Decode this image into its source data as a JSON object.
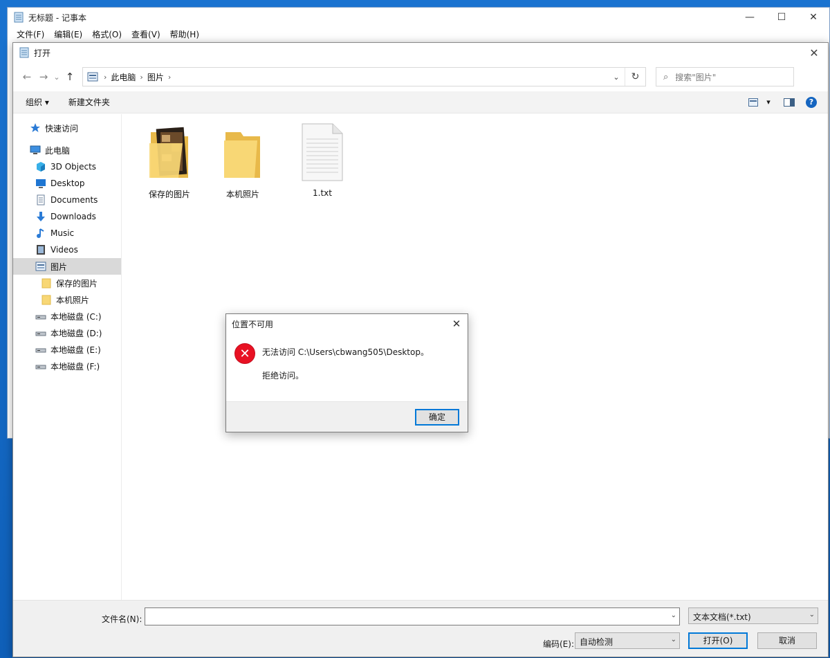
{
  "notepad": {
    "title": "无标题 - 记事本",
    "menu": [
      "文件(F)",
      "编辑(E)",
      "格式(O)",
      "查看(V)",
      "帮助(H)"
    ],
    "minimize": "—",
    "maximize": "☐",
    "close": "✕"
  },
  "open_dialog": {
    "title": "打开",
    "close": "✕",
    "nav": {
      "back": "←",
      "forward": "→",
      "recent": "⌄",
      "up": "↑"
    },
    "address": {
      "crumbs": [
        "此电脑",
        "图片"
      ],
      "separator": "›",
      "dropdown": "⌄",
      "refresh": "↻"
    },
    "search": {
      "placeholder": "搜索\"图片\"",
      "icon": "⌕"
    },
    "commands": {
      "organize": "组织 ▾",
      "new_folder": "新建文件夹"
    },
    "view": {
      "view_arrow": "▾",
      "help": "?"
    },
    "sidebar": [
      {
        "label": "快速访问",
        "icon": "star-icon",
        "indent": 0
      },
      {
        "label": "此电脑",
        "icon": "computer-icon",
        "indent": 0
      },
      {
        "label": "3D Objects",
        "icon": "3d-objects-icon",
        "indent": 1
      },
      {
        "label": "Desktop",
        "icon": "desktop-icon",
        "indent": 1
      },
      {
        "label": "Documents",
        "icon": "document-icon",
        "indent": 1
      },
      {
        "label": "Downloads",
        "icon": "download-icon",
        "indent": 1
      },
      {
        "label": "Music",
        "icon": "music-icon",
        "indent": 1
      },
      {
        "label": "Videos",
        "icon": "video-icon",
        "indent": 1
      },
      {
        "label": "图片",
        "icon": "pictures-icon",
        "indent": 1,
        "selected": true
      },
      {
        "label": "保存的图片",
        "icon": "folder-icon",
        "indent": 2
      },
      {
        "label": "本机照片",
        "icon": "folder-icon",
        "indent": 2
      },
      {
        "label": "本地磁盘 (C:)",
        "icon": "drive-icon",
        "indent": 1
      },
      {
        "label": "本地磁盘 (D:)",
        "icon": "drive-icon",
        "indent": 1
      },
      {
        "label": "本地磁盘 (E:)",
        "icon": "drive-icon",
        "indent": 1
      },
      {
        "label": "本地磁盘 (F:)",
        "icon": "drive-icon",
        "indent": 1
      }
    ],
    "files": [
      {
        "label": "保存的图片",
        "type": "folder-with-images"
      },
      {
        "label": "本机照片",
        "type": "folder"
      },
      {
        "label": "1.txt",
        "type": "text-file"
      }
    ],
    "bottom": {
      "filename_label": "文件名(N):",
      "filename_value": "",
      "dropdown": "⌄",
      "filter": "文本文档(*.txt)",
      "encoding_label": "编码(E):",
      "encoding_value": "自动检测",
      "open_button": "打开(O)",
      "cancel_button": "取消"
    }
  },
  "error_dialog": {
    "title": "位置不可用",
    "close": "✕",
    "icon": "✕",
    "message_line1": "无法访问 C:\\Users\\cbwang505\\Desktop。",
    "message_line2": "拒绝访问。",
    "ok_button": "确定"
  },
  "colors": {
    "accent": "#0078d7",
    "error": "#e81123",
    "folder": "#f8d775",
    "desktop": "#1a73d0"
  }
}
